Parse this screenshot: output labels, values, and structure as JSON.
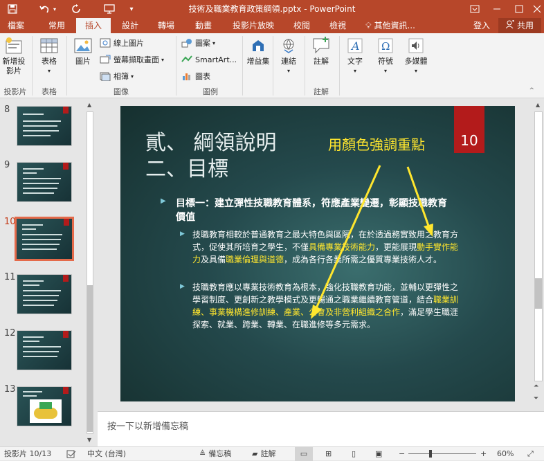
{
  "window": {
    "title": "技術及職業教育政策綱領.pptx - PowerPoint",
    "qat": [
      "save-icon",
      "undo-icon",
      "redo-icon",
      "present-icon",
      "customize-icon"
    ]
  },
  "tabs": [
    "檔案",
    "常用",
    "插入",
    "設計",
    "轉場",
    "動畫",
    "投影片放映",
    "校閱",
    "檢視"
  ],
  "tell_me": "其他資訊...",
  "signin": "登入",
  "share": "共用",
  "ribbon": {
    "groups": {
      "slides": "投影片",
      "tables": "表格",
      "images": "圖像",
      "illustrations": "圖例",
      "comments": "註解"
    },
    "new_slide": "新增投影片",
    "table": "表格",
    "picture": "圖片",
    "online_pictures": "線上圖片",
    "screenshot": "螢幕擷取畫面",
    "album": "相簿",
    "shapes": "圖案",
    "smartart": "SmartArt...",
    "chart": "圖表",
    "addins": "增益集",
    "links": "連結",
    "comment": "註解",
    "text": "文字",
    "symbols": "符號",
    "media": "多媒體"
  },
  "thumbnails": [
    {
      "num": "8"
    },
    {
      "num": "9"
    },
    {
      "num": "10",
      "selected": true
    },
    {
      "num": "11"
    },
    {
      "num": "12"
    },
    {
      "num": "13"
    }
  ],
  "slide": {
    "title1": "貳、 綱領說明",
    "title2": "二、目標",
    "slide_number": "10",
    "annotation": "用顏色強調重點",
    "bullet_main": "目標一：建立彈性技職教育體系，符應產業變遷，彰顯技職教育價值",
    "sub1": {
      "t1": "技職教育相較於普通教育之最大特色與區隔，在於透過務實致用之教育方式，促使其所培育之學生，不僅",
      "h1": "具備專業技術能力",
      "t2": "，更能展現",
      "h2": "動手實作能力",
      "t3": "及具備",
      "h3": "職業倫理與道德",
      "t4": "，成為各行各業所需之優質專業技術人才。"
    },
    "sub2": {
      "t1": "技職教育應以專業技術教育為根本，強化技職教育功能，並輔以更彈性之學習制度、更創新之教學模式及更暢通之職業繼續教育管道，結合",
      "h1": "職業訓練、事業機構進修訓練、產業、公會及非營利組織之合作",
      "t2": "，滿足學生職涯探索、就業、跨業、轉業、在職進修等多元需求。"
    },
    "accent_color": "#ffe62e",
    "number_box_color": "#b31b1b"
  },
  "notes_placeholder": "按一下以新增備忘稿",
  "status": {
    "slide_info": "投影片 10/13",
    "language": "中文 (台灣)",
    "notes": "備忘稿",
    "comments": "註解",
    "zoom": "60%"
  }
}
